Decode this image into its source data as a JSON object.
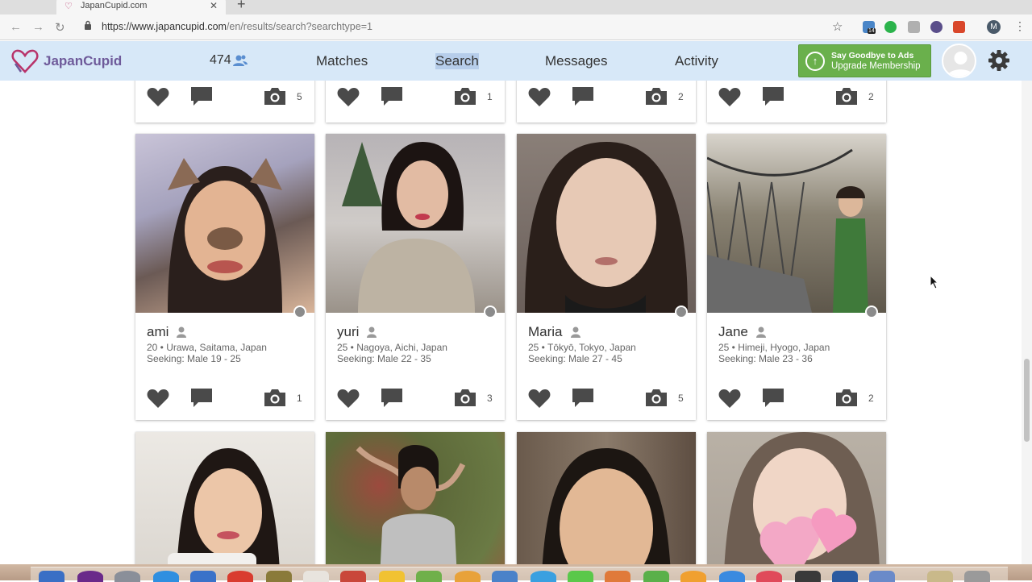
{
  "browser": {
    "tab_title": "JapanCupid.com",
    "url_host": "https://www.japancupid.com",
    "url_path": "/en/results/search?searchtype=1",
    "ext_badge": "14",
    "profile_initial": "M"
  },
  "header": {
    "logo_text": "JapanCupid",
    "member_count": "474",
    "nav": [
      "Matches",
      "Search",
      "Messages",
      "Activity"
    ],
    "active_nav": "Search",
    "upgrade_line1": "Say Goodbye to Ads",
    "upgrade_line2": "Upgrade Membership",
    "colors": {
      "header_bg": "#d7e8f8",
      "upgrade_green": "#6ab04c",
      "logo_purple": "#6e5a9a"
    }
  },
  "prev_row_photo_counts": [
    "5",
    "1",
    "2",
    "2"
  ],
  "profiles": [
    {
      "name": "ami",
      "details": "20 • Urawa, Saitama, Japan",
      "seeking": "Seeking: Male 19 - 25",
      "photos": "1"
    },
    {
      "name": "yuri",
      "details": "25 • Nagoya, Aichi, Japan",
      "seeking": "Seeking: Male 22 - 35",
      "photos": "3"
    },
    {
      "name": "Maria",
      "details": "25 • Tōkyō, Tokyo, Japan",
      "seeking": "Seeking: Male 27 - 45",
      "photos": "5"
    },
    {
      "name": "Jane",
      "details": "25 • Himeji, Hyogo, Japan",
      "seeking": "Seeking: Male 23 - 36",
      "photos": "2"
    }
  ]
}
